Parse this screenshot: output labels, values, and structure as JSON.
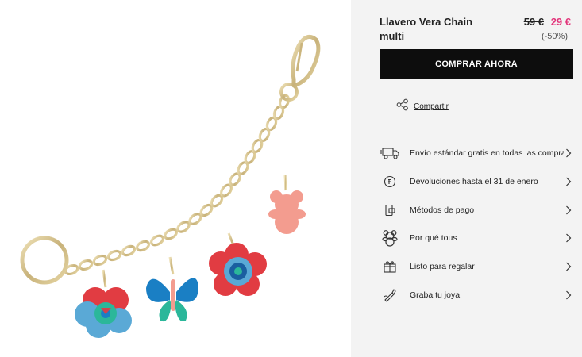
{
  "product": {
    "title": "Llavero Vera Chain multi",
    "price_old": "59 €",
    "price_new": "29 €",
    "discount": "(-50%)"
  },
  "buy_button": {
    "label": "COMPRAR AHORA"
  },
  "share": {
    "label": "Compartir"
  },
  "services": [
    {
      "label": "Envío estándar gratis en todas las compras",
      "icon": "truck-icon"
    },
    {
      "label": "Devoluciones hasta el 31 de enero",
      "icon": "return-icon"
    },
    {
      "label": "Métodos de pago",
      "icon": "payment-icon"
    },
    {
      "label": "Por qué tous",
      "icon": "bear-icon"
    },
    {
      "label": "Listo para regalar",
      "icon": "gift-icon"
    },
    {
      "label": "Graba tu joya",
      "icon": "engrave-icon"
    }
  ],
  "colors": {
    "accent_price": "#e2347a",
    "button_bg": "#0d0d0d",
    "panel_bg": "#f3f3f3"
  }
}
